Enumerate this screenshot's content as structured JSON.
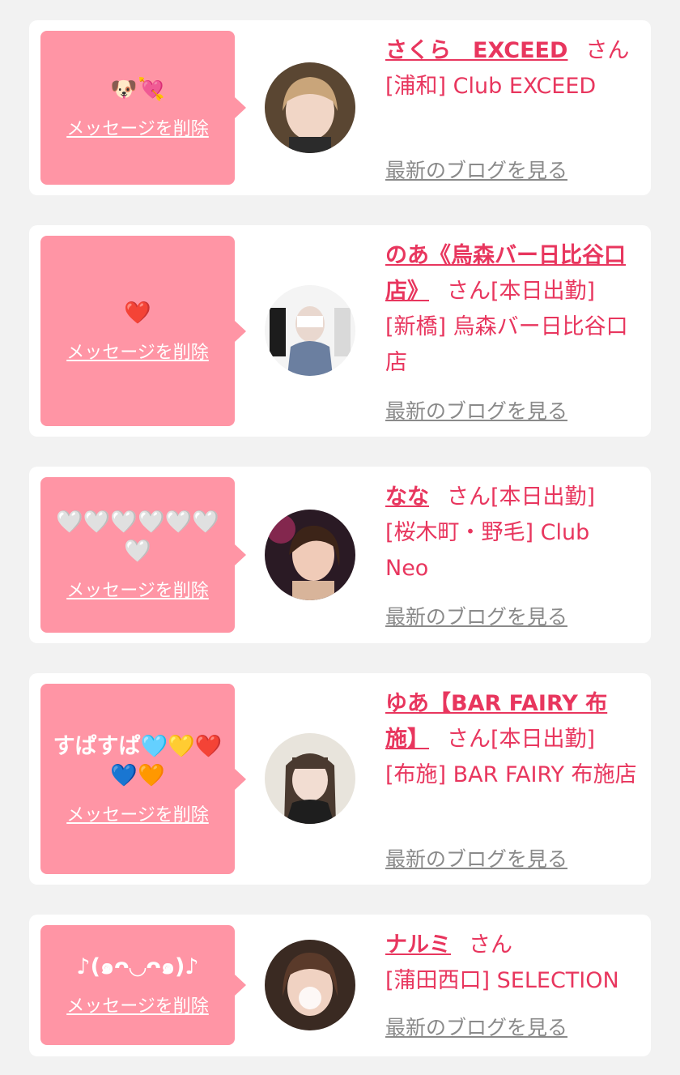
{
  "cards": [
    {
      "message": "🐶💘",
      "delete_label": "メッセージを削除",
      "avatar_icon": "cast-photo-avatar",
      "name": "さくら　EXCEED",
      "honorific": "さん",
      "status": "",
      "shop": "[浦和] Club EXCEED",
      "blog_link": "最新のブログを見る"
    },
    {
      "message": "❤️",
      "delete_label": "メッセージを削除",
      "avatar_icon": "cast-photo-avatar",
      "name": "のあ《烏森バー日比谷口店》",
      "honorific": "さん",
      "status": "[本日出勤]",
      "shop": "[新橋] 烏森バー日比谷口店",
      "blog_link": "最新のブログを見る"
    },
    {
      "message": "🤍🤍🤍🤍🤍🤍🤍",
      "delete_label": "メッセージを削除",
      "avatar_icon": "cast-photo-avatar",
      "name": "なな",
      "honorific": "さん",
      "status": "[本日出勤]",
      "shop": "[桜木町・野毛] Club Neo",
      "blog_link": "最新のブログを見る"
    },
    {
      "message": "すぱすぱ🩵💛❤️💙🧡",
      "delete_label": "メッセージを削除",
      "avatar_icon": "cast-photo-avatar",
      "name": "ゆあ【BAR FAIRY 布施】",
      "honorific": "さん",
      "status": "[本日出勤]",
      "shop": "[布施] BAR FAIRY 布施店",
      "blog_link": "最新のブログを見る"
    },
    {
      "message": "♪(๑ᴖ◡ᴖ๑)♪",
      "delete_label": "メッセージを削除",
      "avatar_icon": "cast-photo-avatar",
      "name": "ナルミ",
      "honorific": "さん",
      "status": "",
      "shop": "[蒲田西口] SELECTION",
      "blog_link": "最新のブログを見る"
    }
  ],
  "colors": {
    "page_bg": "#f2f2f2",
    "card_bg": "#ffffff",
    "bubble_bg": "#ff95a5",
    "accent": "#e8365e",
    "link_gray": "#8a8a8a"
  }
}
